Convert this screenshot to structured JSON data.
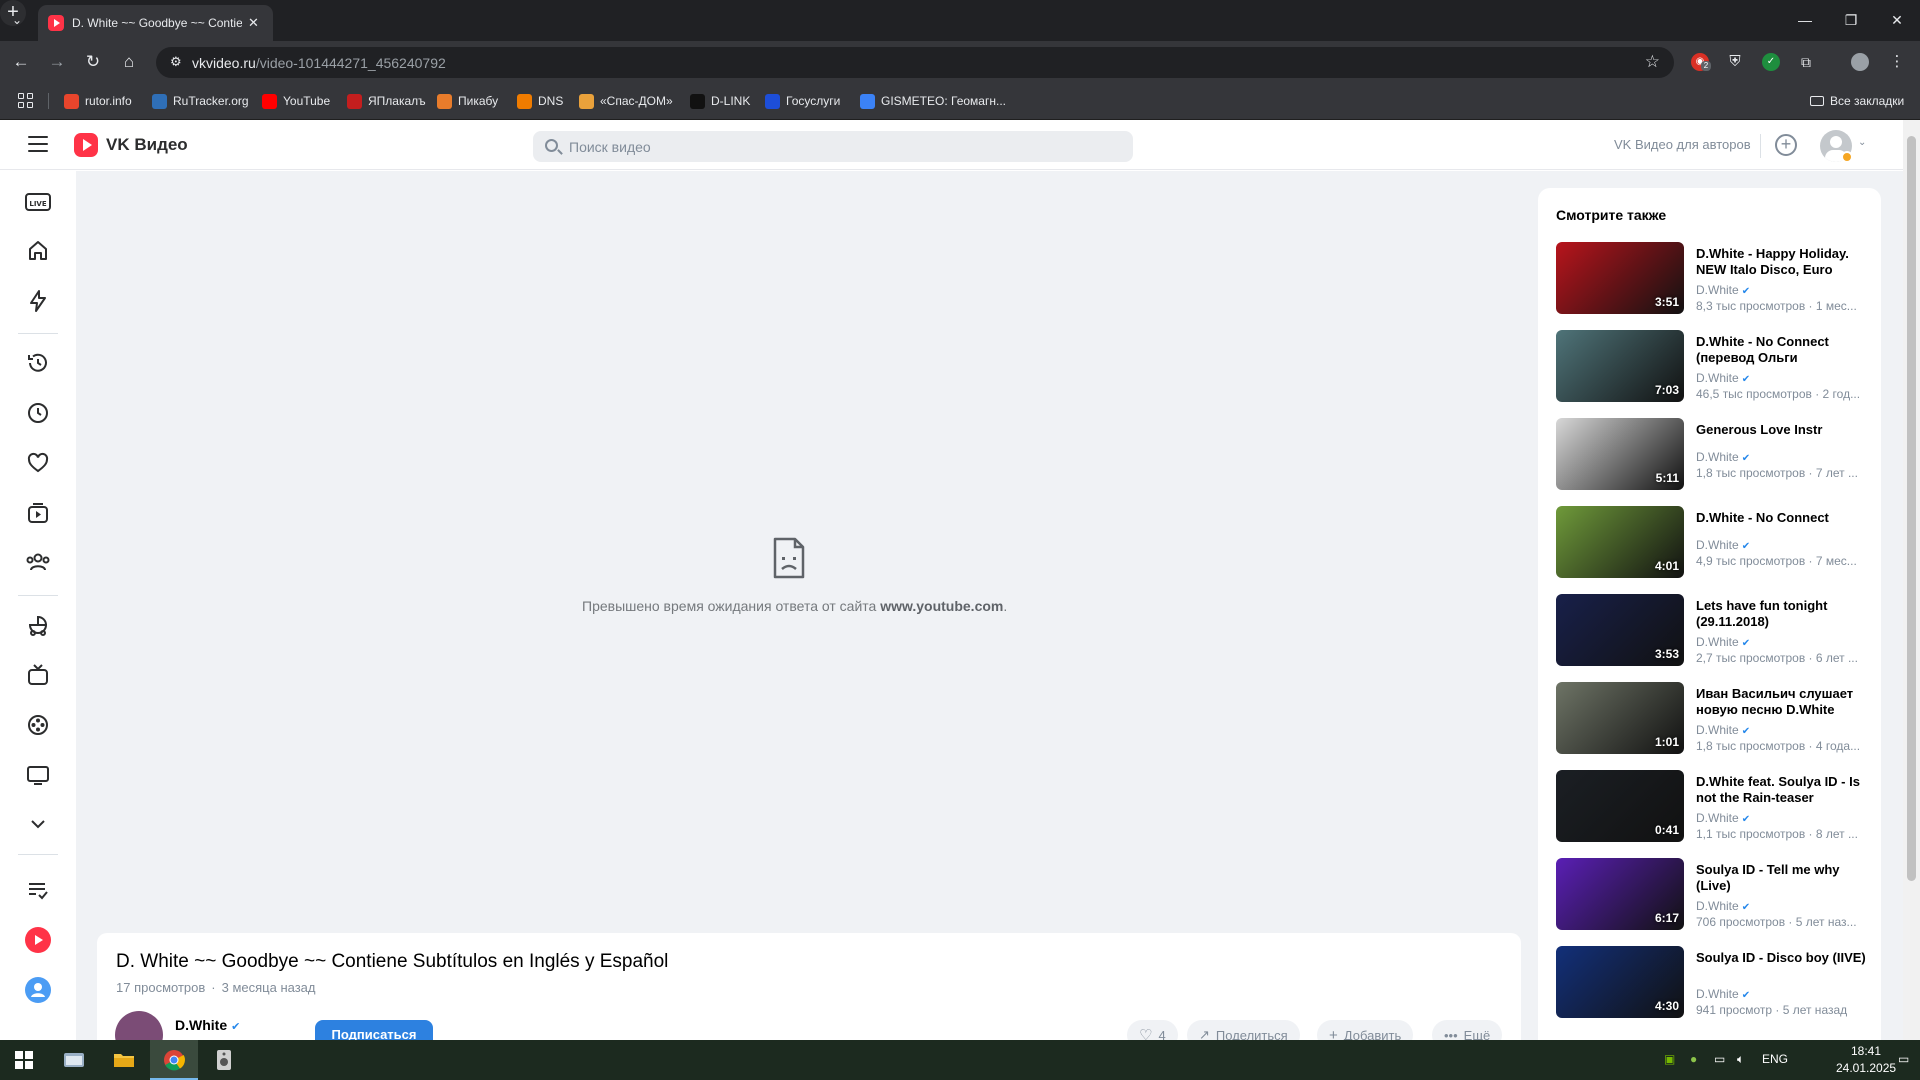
{
  "browser": {
    "tab_title": "D. White ~~ Goodbye ~~ Contiene Subtítulos en Inglés y Español",
    "url_host": "vkvideo.ru",
    "url_path": "/video-101444271_456240792",
    "bookmarks": [
      {
        "label": "rutor.info",
        "icon": "rutor-icon",
        "color": "#e8452c"
      },
      {
        "label": "RuTracker.org",
        "icon": "rutracker-icon",
        "color": "#2f6fb7"
      },
      {
        "label": "YouTube",
        "icon": "youtube-icon",
        "color": "#ff0000"
      },
      {
        "label": "ЯПлакалъ",
        "icon": "yaplakal-icon",
        "color": "#c41e1e"
      },
      {
        "label": "Пикабу",
        "icon": "pikabu-icon",
        "color": "#e87c2b"
      },
      {
        "label": "DNS",
        "icon": "dns-icon",
        "color": "#f07c00"
      },
      {
        "label": "«Спас-ДОМ»",
        "icon": "spasdom-icon",
        "color": "#e9a13b"
      },
      {
        "label": "D-LINK",
        "icon": "dlink-icon",
        "color": "#111111"
      },
      {
        "label": "Госуслуги",
        "icon": "gosuslugi-icon",
        "color": "#1d4ed8"
      },
      {
        "label": "GISMETEO: Геомагн...",
        "icon": "gismeteo-icon",
        "color": "#3b82f6"
      }
    ],
    "all_bookmarks": "Все закладки",
    "ext_badge": "2"
  },
  "vk": {
    "brand": "VK Видео",
    "search_placeholder": "Поиск видео",
    "authors_link": "VK Видео для авторов"
  },
  "player": {
    "error_prefix": "Превышено время ожидания ответа от сайта ",
    "error_host": "www.youtube.com",
    "error_suffix": "."
  },
  "video": {
    "title": "D. White ~~ Goodbye ~~ Contiene Subtítulos en Inglés y Español",
    "views": "17 просмотров",
    "age": "3 месяца назад",
    "channel": "D.White",
    "subscribe": "Подписаться",
    "likes": "4",
    "share": "Поделиться",
    "add": "Добавить",
    "more": "Ещё"
  },
  "recommendations": {
    "title": "Смотрите также",
    "items": [
      {
        "title": "D.White - Happy Holiday. NEW Italo Disco, Euro Disc...",
        "duration": "3:51",
        "channel": "D.White",
        "stats": "8,3 тыс просмотров · 1 мес...",
        "thumb": "#b8141c"
      },
      {
        "title": "D.White - No Connect (перевод Ольги Конради...",
        "duration": "7:03",
        "channel": "D.White",
        "stats": "46,5 тыс просмотров · 2 год...",
        "thumb": "#4f7479"
      },
      {
        "title": "Generous Love Instr",
        "duration": "5:11",
        "channel": "D.White",
        "stats": "1,8 тыс просмотров · 7 лет ...",
        "thumb": "#d8d8d8"
      },
      {
        "title": "D.White - No Connect",
        "duration": "4:01",
        "channel": "D.White",
        "stats": "4,9 тыс просмотров · 7 мес...",
        "thumb": "#6f9a3a"
      },
      {
        "title": "Lets have fun tonight (29.11.2018)",
        "duration": "3:53",
        "channel": "D.White",
        "stats": "2,7 тыс просмотров · 6 лет ...",
        "thumb": "#18204a"
      },
      {
        "title": "Иван Васильич слушает новую песню D.White",
        "duration": "1:01",
        "channel": "D.White",
        "stats": "1,8 тыс просмотров · 4 года...",
        "thumb": "#6e7466"
      },
      {
        "title": "D.White feat. Soulya ID - Is not the Rain-teaser",
        "duration": "0:41",
        "channel": "D.White",
        "stats": "1,1 тыс просмотров · 8 лет ...",
        "thumb": "#1b1f24"
      },
      {
        "title": "Soulya ID - Tell me why (Live)",
        "duration": "6:17",
        "channel": "D.White",
        "stats": "706 просмотров · 5 лет наз...",
        "thumb": "#5a1fb5"
      },
      {
        "title": "Soulya ID - Disco boy (IIVE)",
        "duration": "4:30",
        "channel": "D.White",
        "stats": "941 просмотр · 5 лет назад",
        "thumb": "#12307a"
      }
    ]
  },
  "taskbar": {
    "lang": "ENG",
    "time": "18:41",
    "date": "24.01.2025"
  }
}
